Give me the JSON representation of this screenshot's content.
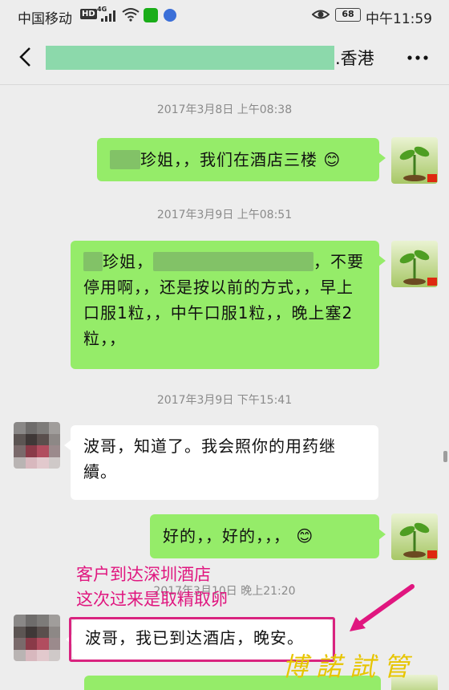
{
  "status_bar": {
    "carrier": "中国移动",
    "hd": "HD",
    "net": "4G",
    "battery": "68",
    "time": "中午11:59"
  },
  "nav": {
    "title_suffix": ".香港",
    "back_icon": "chevron-left-icon",
    "more_icon": "more-horizontal-icon"
  },
  "timestamps": [
    "2017年3月8日 上午08:38",
    "2017年3月9日 上午08:51",
    "2017年3月9日 下午15:41",
    "2017年3月10日 晚上21:20"
  ],
  "messages": [
    {
      "from": "me",
      "text": "珍姐，，我们在酒店三楼"
    },
    {
      "from": "me",
      "text_a": "珍姐，",
      "text_b": "，不要停用啊，，还是按以前的方式，，早上口服1粒，，中午口服1粒，，晚上塞2粒，，"
    },
    {
      "from": "them",
      "text": "波哥，知道了。我会照你的用药继續。"
    },
    {
      "from": "me",
      "text": "好的，，好的，，，"
    },
    {
      "from": "them",
      "text": "波哥，我已到达酒店，晚安。"
    }
  ],
  "annotation": {
    "line1": "客户到达深圳酒店",
    "line2": "这次过来是取精取卵",
    "color": "#e0167f"
  },
  "watermark": "博諾試管",
  "colors": {
    "bubble_me": "#95ec69",
    "bubble_them": "#ffffff",
    "background": "#ededed"
  }
}
